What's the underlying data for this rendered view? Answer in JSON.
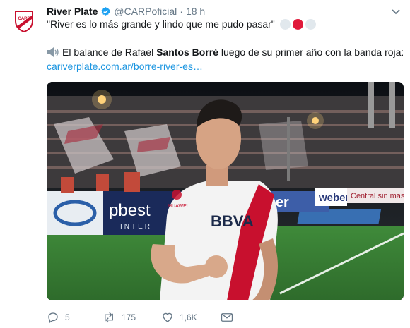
{
  "tweet": {
    "author_name": "River Plate",
    "author_handle": "@CARPoficial",
    "separator": "·",
    "time": "18 h",
    "quote": "\"River es lo más grande y lindo que me pudo pasar\"",
    "emoji_colors": [
      "#e1e8ed",
      "#e0193a",
      "#e1e8ed"
    ],
    "line2_prefix": "El balance de Rafael ",
    "line2_bold": "Santos Borré",
    "line2_suffix": " luego de su primer año con la banda roja:",
    "link": "cariverplate.com.ar/borre-river-es…",
    "icons": {
      "avatar": "river-plate-crest-icon",
      "verified": "verified-badge-icon",
      "caret": "chevron-down-icon",
      "speaker": "speaker-icon",
      "reply": "reply-icon",
      "retweet": "retweet-icon",
      "like": "heart-icon",
      "dm": "envelope-icon"
    }
  },
  "media": {
    "ad_boards": [
      "pbest",
      "INTER",
      "weber",
      "weber",
      "Central sin mas"
    ],
    "shirt_sponsor": "BBVA",
    "shirt_brand": "HUAWEI"
  },
  "actions": {
    "replies": "5",
    "retweets": "175",
    "likes": "1,6K"
  },
  "colors": {
    "accent_red": "#e0193a",
    "link_blue": "#1b95e0",
    "muted_gray": "#657786"
  }
}
